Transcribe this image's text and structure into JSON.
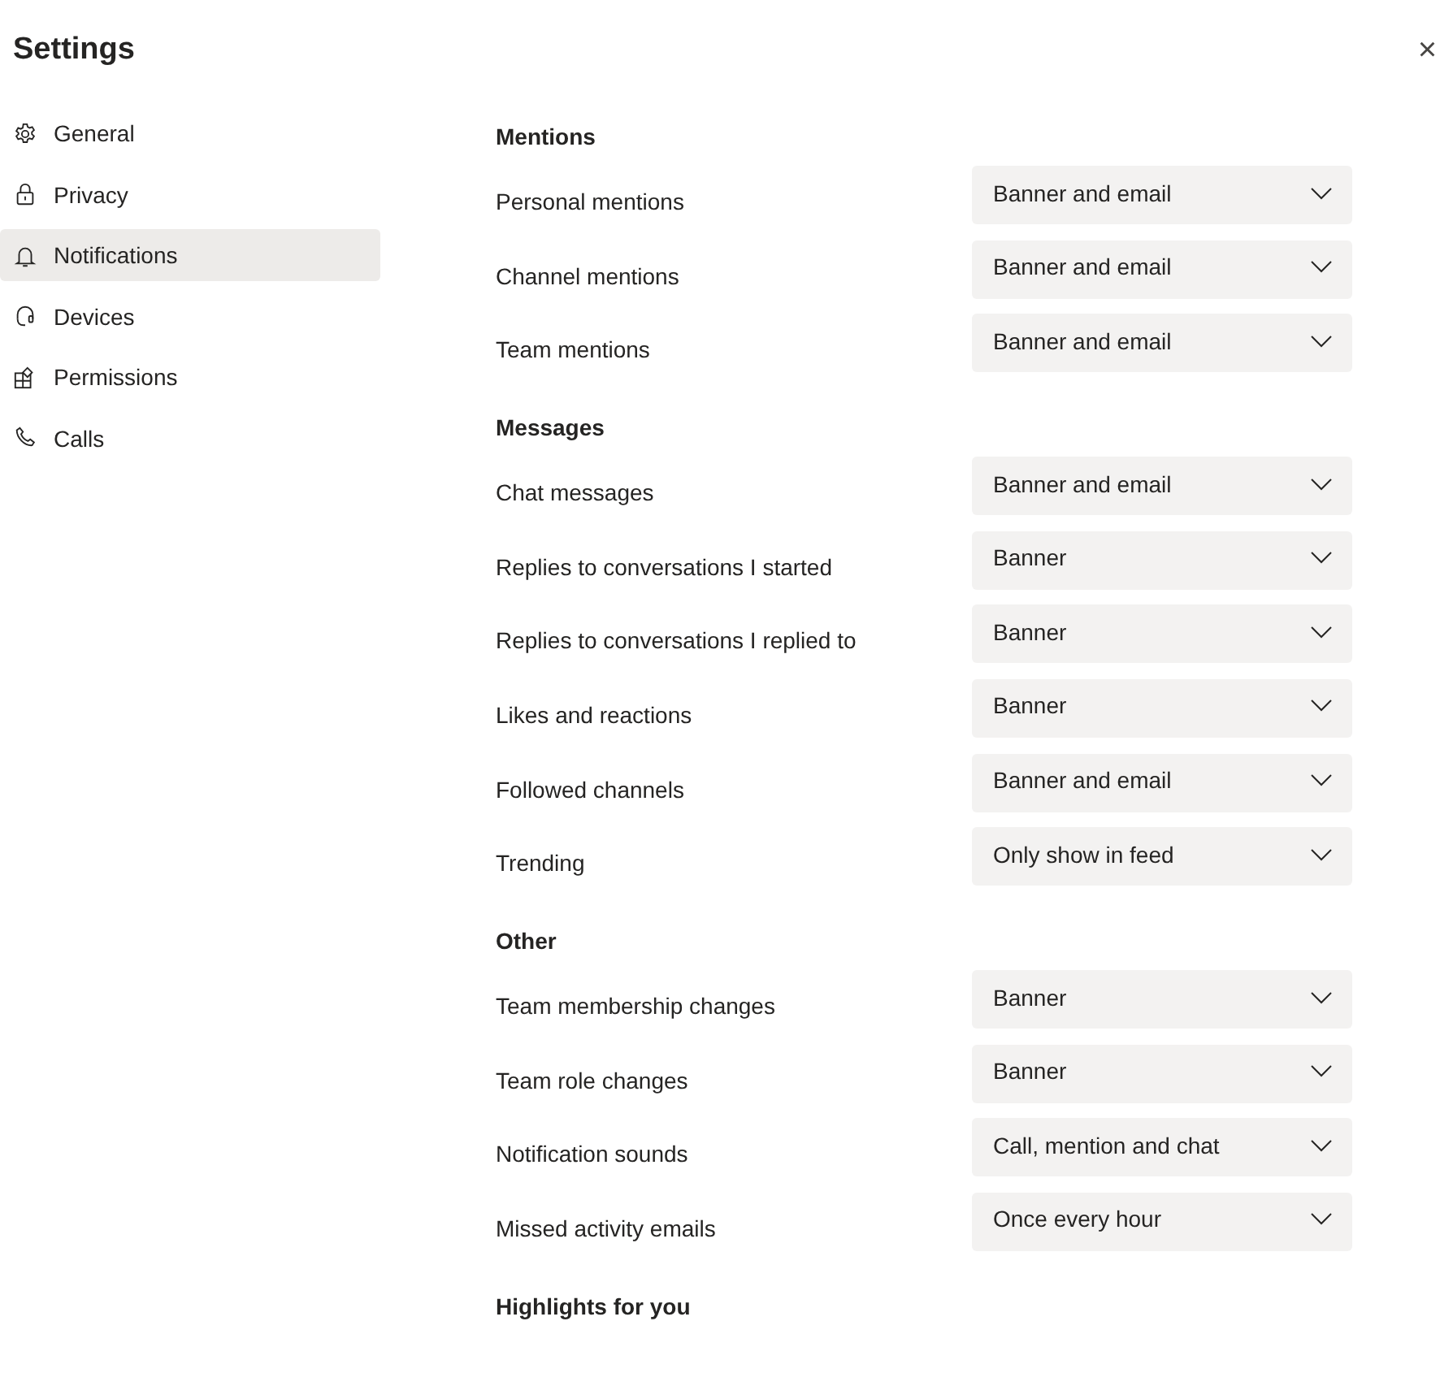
{
  "window": {
    "title": "Settings",
    "close": "×"
  },
  "sidebar": {
    "items": [
      {
        "label": "General",
        "selected": false
      },
      {
        "label": "Privacy",
        "selected": false
      },
      {
        "label": "Notifications",
        "selected": true
      },
      {
        "label": "Devices",
        "selected": false
      },
      {
        "label": "Permissions",
        "selected": false
      },
      {
        "label": "Calls",
        "selected": false
      }
    ]
  },
  "sections": [
    {
      "heading": "Mentions",
      "rows": [
        {
          "label": "Personal mentions",
          "value": "Banner and email"
        },
        {
          "label": "Channel mentions",
          "value": "Banner and email"
        },
        {
          "label": "Team mentions",
          "value": "Banner and email"
        }
      ]
    },
    {
      "heading": "Messages",
      "rows": [
        {
          "label": "Chat messages",
          "value": "Banner and email"
        },
        {
          "label": "Replies to conversations I started",
          "value": "Banner"
        },
        {
          "label": "Replies to conversations I replied to",
          "value": "Banner"
        },
        {
          "label": "Likes and reactions",
          "value": "Banner"
        },
        {
          "label": "Followed channels",
          "value": "Banner and email"
        },
        {
          "label": "Trending",
          "value": "Only show in feed"
        }
      ]
    },
    {
      "heading": "Other",
      "rows": [
        {
          "label": "Team membership changes",
          "value": "Banner"
        },
        {
          "label": "Team role changes",
          "value": "Banner"
        },
        {
          "label": "Notification sounds",
          "value": "Call, mention and chat"
        },
        {
          "label": "Missed activity emails",
          "value": "Once every hour"
        }
      ]
    },
    {
      "heading": "Highlights for you"
    }
  ]
}
